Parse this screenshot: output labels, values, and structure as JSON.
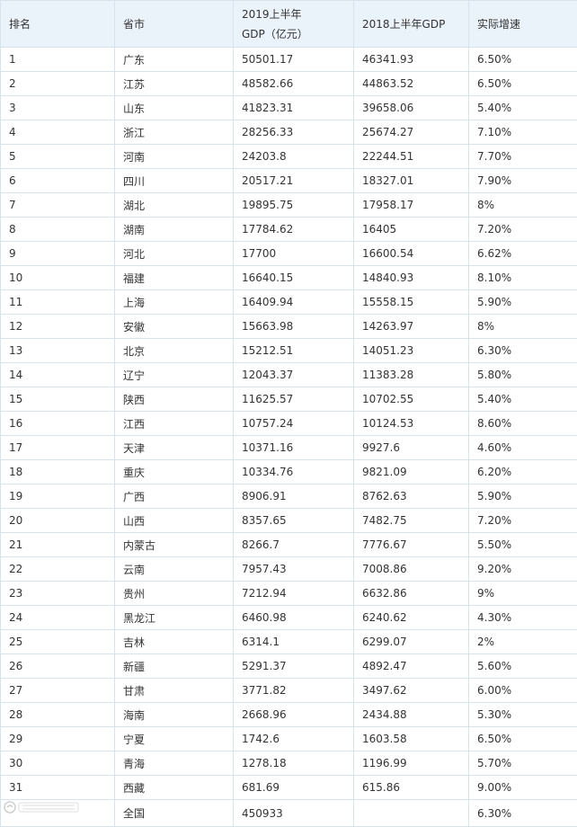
{
  "table": {
    "headers": {
      "rank": "排名",
      "province": "省市",
      "gdp2019_line1": "2019上半年",
      "gdp2019_line2": "GDP（亿元）",
      "gdp2018": "2018上半年GDP",
      "growth": "实际增速"
    },
    "rows": [
      {
        "rank": "1",
        "province": "广东",
        "gdp2019": "50501.17",
        "gdp2018": "46341.93",
        "growth": "6.50%"
      },
      {
        "rank": "2",
        "province": "江苏",
        "gdp2019": "48582.66",
        "gdp2018": "44863.52",
        "growth": "6.50%"
      },
      {
        "rank": "3",
        "province": "山东",
        "gdp2019": "41823.31",
        "gdp2018": "39658.06",
        "growth": "5.40%"
      },
      {
        "rank": "4",
        "province": "浙江",
        "gdp2019": "28256.33",
        "gdp2018": "25674.27",
        "growth": "7.10%"
      },
      {
        "rank": "5",
        "province": "河南",
        "gdp2019": "24203.8",
        "gdp2018": "22244.51",
        "growth": "7.70%"
      },
      {
        "rank": "6",
        "province": "四川",
        "gdp2019": "20517.21",
        "gdp2018": "18327.01",
        "growth": "7.90%"
      },
      {
        "rank": "7",
        "province": "湖北",
        "gdp2019": "19895.75",
        "gdp2018": "17958.17",
        "growth": "8%"
      },
      {
        "rank": "8",
        "province": "湖南",
        "gdp2019": "17784.62",
        "gdp2018": "16405",
        "growth": "7.20%"
      },
      {
        "rank": "9",
        "province": "河北",
        "gdp2019": "17700",
        "gdp2018": "16600.54",
        "growth": "6.62%"
      },
      {
        "rank": "10",
        "province": "福建",
        "gdp2019": "16640.15",
        "gdp2018": "14840.93",
        "growth": "8.10%"
      },
      {
        "rank": "11",
        "province": "上海",
        "gdp2019": "16409.94",
        "gdp2018": "15558.15",
        "growth": "5.90%"
      },
      {
        "rank": "12",
        "province": "安徽",
        "gdp2019": "15663.98",
        "gdp2018": "14263.97",
        "growth": "8%"
      },
      {
        "rank": "13",
        "province": "北京",
        "gdp2019": "15212.51",
        "gdp2018": "14051.23",
        "growth": "6.30%"
      },
      {
        "rank": "14",
        "province": "辽宁",
        "gdp2019": "12043.37",
        "gdp2018": "11383.28",
        "growth": "5.80%"
      },
      {
        "rank": "15",
        "province": "陕西",
        "gdp2019": "11625.57",
        "gdp2018": "10702.55",
        "growth": "5.40%"
      },
      {
        "rank": "16",
        "province": "江西",
        "gdp2019": "10757.24",
        "gdp2018": "10124.53",
        "growth": "8.60%"
      },
      {
        "rank": "17",
        "province": "天津",
        "gdp2019": "10371.16",
        "gdp2018": "9927.6",
        "growth": "4.60%"
      },
      {
        "rank": "18",
        "province": "重庆",
        "gdp2019": "10334.76",
        "gdp2018": "9821.09",
        "growth": "6.20%"
      },
      {
        "rank": "19",
        "province": "广西",
        "gdp2019": "8906.91",
        "gdp2018": "8762.63",
        "growth": "5.90%"
      },
      {
        "rank": "20",
        "province": "山西",
        "gdp2019": "8357.65",
        "gdp2018": "7482.75",
        "growth": "7.20%"
      },
      {
        "rank": "21",
        "province": "内蒙古",
        "gdp2019": "8266.7",
        "gdp2018": "7776.67",
        "growth": "5.50%"
      },
      {
        "rank": "22",
        "province": "云南",
        "gdp2019": "7957.43",
        "gdp2018": "7008.86",
        "growth": "9.20%"
      },
      {
        "rank": "23",
        "province": "贵州",
        "gdp2019": "7212.94",
        "gdp2018": "6632.86",
        "growth": "9%"
      },
      {
        "rank": "24",
        "province": "黑龙江",
        "gdp2019": "6460.98",
        "gdp2018": "6240.62",
        "growth": "4.30%"
      },
      {
        "rank": "25",
        "province": "吉林",
        "gdp2019": "6314.1",
        "gdp2018": "6299.07",
        "growth": "2%"
      },
      {
        "rank": "26",
        "province": "新疆",
        "gdp2019": "5291.37",
        "gdp2018": "4892.47",
        "growth": "5.60%"
      },
      {
        "rank": "27",
        "province": "甘肃",
        "gdp2019": "3771.82",
        "gdp2018": "3497.62",
        "growth": "6.00%"
      },
      {
        "rank": "28",
        "province": "海南",
        "gdp2019": "2668.96",
        "gdp2018": "2434.88",
        "growth": "5.30%"
      },
      {
        "rank": "29",
        "province": "宁夏",
        "gdp2019": "1742.6",
        "gdp2018": "1603.58",
        "growth": "6.50%"
      },
      {
        "rank": "30",
        "province": "青海",
        "gdp2019": "1278.18",
        "gdp2018": "1196.99",
        "growth": "5.70%"
      },
      {
        "rank": "31",
        "province": "西藏",
        "gdp2019": "681.69",
        "gdp2018": "615.86",
        "growth": "9.00%"
      }
    ],
    "total": {
      "rank": "",
      "province": "全国",
      "gdp2019": "450933",
      "gdp2018": "",
      "growth": "6.30%"
    }
  },
  "colors": {
    "header_bg": "#eaf2fa",
    "border": "#d6e3ef",
    "text": "#333333"
  }
}
